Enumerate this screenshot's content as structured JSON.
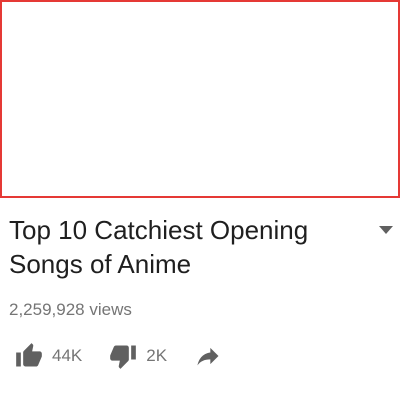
{
  "video": {
    "title_line1": "Top 10 Catchiest Opening",
    "title_line2": "Songs of Anime",
    "views": "2,259,928 views"
  },
  "actions": {
    "likes": "44K",
    "dislikes": "2K"
  },
  "icons": {
    "expand": "chevron-down-icon",
    "like": "thumbs-up-icon",
    "dislike": "thumbs-down-icon",
    "share": "share-arrow-icon"
  },
  "colors": {
    "player_border": "#e53935",
    "title": "#1f1f1f",
    "meta": "#757575",
    "icon": "#606060"
  }
}
